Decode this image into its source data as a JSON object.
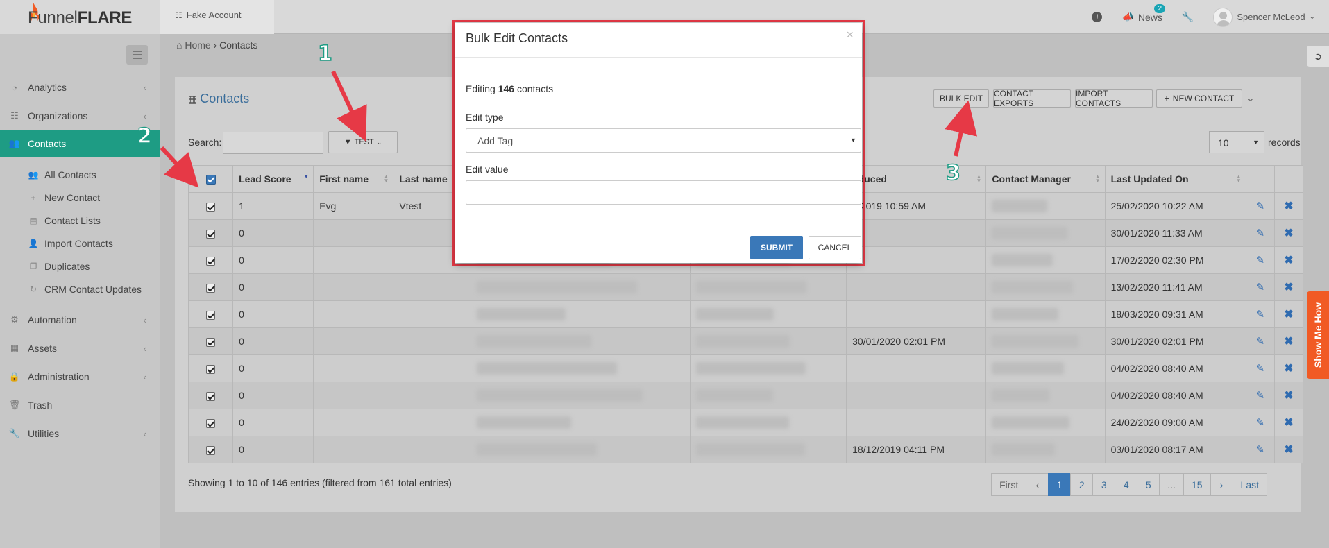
{
  "brand": {
    "logo_light": "Funnel",
    "logo_bold": "FLARE"
  },
  "account_tab": {
    "label": "Fake Account"
  },
  "topbar": {
    "news_label": "News",
    "news_badge": "2",
    "user_name": "Spencer McLeod"
  },
  "sidebar": {
    "items": [
      {
        "label": "Analytics"
      },
      {
        "label": "Organizations"
      },
      {
        "label": "Contacts"
      },
      {
        "label": "Automation"
      },
      {
        "label": "Assets"
      },
      {
        "label": "Administration"
      },
      {
        "label": "Trash"
      },
      {
        "label": "Utilities"
      }
    ],
    "subitems": [
      {
        "label": "All Contacts"
      },
      {
        "label": "New Contact"
      },
      {
        "label": "Contact Lists"
      },
      {
        "label": "Import Contacts"
      },
      {
        "label": "Duplicates"
      },
      {
        "label": "CRM Contact Updates"
      }
    ]
  },
  "breadcrumb": {
    "home": "Home",
    "current": "Contacts"
  },
  "card": {
    "title": "Contacts",
    "buttons": {
      "bulk_edit": "BULK EDIT",
      "exports": "CONTACT EXPORTS",
      "import": "IMPORT CONTACTS",
      "new": "NEW CONTACT"
    },
    "search_label": "Search:",
    "filter_label": "TEST",
    "records_value": "10",
    "records_label": "records"
  },
  "table": {
    "headers": [
      "Lead Score",
      "First name",
      "Last name",
      "oduced",
      "Contact Manager",
      "Last Updated On"
    ],
    "rows": [
      {
        "score": "1",
        "first": "Evg",
        "last": "Vtest",
        "introduced": "1/2019 10:59 AM",
        "updated": "25/02/2020 10:22 AM"
      },
      {
        "score": "0",
        "first": "",
        "last": "",
        "introduced": "",
        "updated": "30/01/2020 11:33 AM"
      },
      {
        "score": "0",
        "first": "",
        "last": "",
        "introduced": "",
        "updated": "17/02/2020 02:30 PM"
      },
      {
        "score": "0",
        "first": "",
        "last": "",
        "introduced": "",
        "updated": "13/02/2020 11:41 AM"
      },
      {
        "score": "0",
        "first": "",
        "last": "",
        "introduced": "",
        "updated": "18/03/2020 09:31 AM"
      },
      {
        "score": "0",
        "first": "",
        "last": "",
        "introduced": "30/01/2020 02:01 PM",
        "updated": "30/01/2020 02:01 PM"
      },
      {
        "score": "0",
        "first": "",
        "last": "",
        "introduced": "",
        "updated": "04/02/2020 08:40 AM"
      },
      {
        "score": "0",
        "first": "",
        "last": "",
        "introduced": "",
        "updated": "04/02/2020 08:40 AM"
      },
      {
        "score": "0",
        "first": "",
        "last": "",
        "introduced": "",
        "updated": "24/02/2020 09:00 AM"
      },
      {
        "score": "0",
        "first": "",
        "last": "",
        "introduced": "18/12/2019 04:11 PM",
        "updated": "03/01/2020 08:17 AM"
      }
    ]
  },
  "footer": {
    "entries": "Showing 1 to 10 of 146 entries (filtered from 161 total entries)"
  },
  "pagination": [
    "First",
    "‹",
    "1",
    "2",
    "3",
    "4",
    "5",
    "...",
    "15",
    "›",
    "Last"
  ],
  "show_me_how": "Show Me How",
  "modal": {
    "title": "Bulk Edit Contacts",
    "close": "×",
    "editing_prefix": "Editing ",
    "editing_count": "146",
    "editing_suffix": " contacts",
    "edit_type_label": "Edit type",
    "edit_type_value": "Add Tag",
    "edit_value_label": "Edit value",
    "submit": "SUBMIT",
    "cancel": "CANCEL"
  },
  "annotations": [
    "1",
    "2",
    "3"
  ],
  "colors": {
    "accent": "#1e9c84",
    "primary": "#3a78b8",
    "annotation": "#e63946",
    "cta": "#f15a24"
  }
}
